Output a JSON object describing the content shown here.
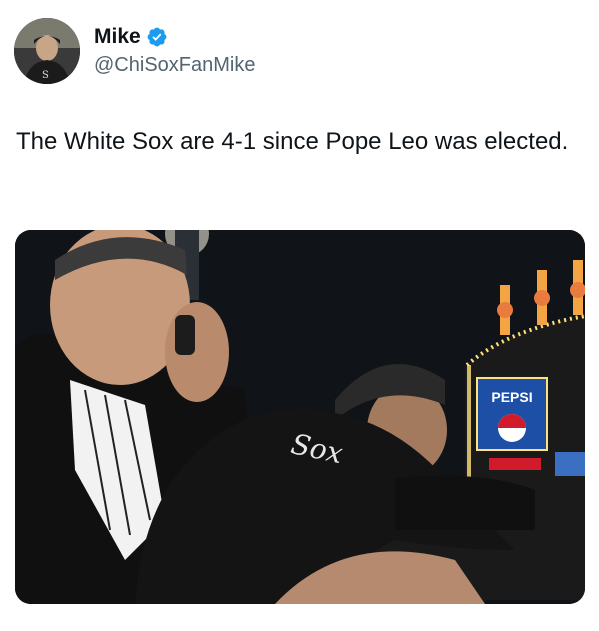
{
  "author": {
    "display_name": "Mike",
    "handle": "@ChiSoxFanMike",
    "verified": true,
    "verified_color": "#1d9bf0"
  },
  "tweet": {
    "text": "The White Sox are 4-1 since Pope Leo was elected."
  },
  "media": {
    "type": "photo",
    "scoreboard_sign": "PEPSI",
    "cap_logo": "Sox"
  },
  "icons": [
    "verified-badge-icon"
  ],
  "colors": {
    "text_primary": "#0f1419",
    "text_secondary": "#536471",
    "background": "#ffffff"
  }
}
